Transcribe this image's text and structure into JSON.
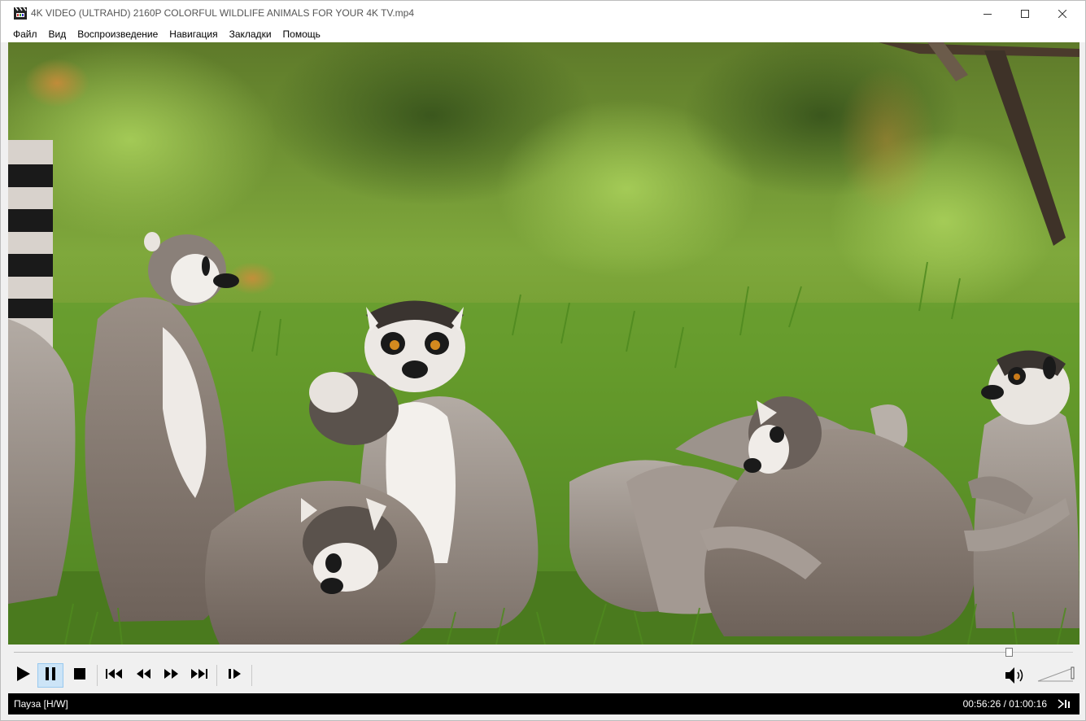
{
  "window": {
    "title": "4K VIDEO (ULTRAHD) 2160P COLORFUL WILDLIFE ANIMALS FOR YOUR 4K TV.mp4",
    "app_icon": "clapperboard-icon",
    "buttons": {
      "minimize": "minimize-icon",
      "maximize": "maximize-icon",
      "close": "close-icon"
    }
  },
  "menu": {
    "items": [
      "Файл",
      "Вид",
      "Воспроизведение",
      "Навигация",
      "Закладки",
      "Помощь"
    ]
  },
  "video": {
    "content": "video-frame"
  },
  "seekbar": {
    "progress": 0.9397
  },
  "controls": {
    "play": "play-icon",
    "pause": "pause-icon",
    "stop": "stop-icon",
    "prev": "skip-previous-icon",
    "rewind": "rewind-icon",
    "forward": "fast-forward-icon",
    "next": "skip-next-icon",
    "frame_step": "frame-step-icon",
    "volume": "speaker-icon",
    "active_button": "pause"
  },
  "status": {
    "state": "Пауза [H/W]",
    "time": "00:56:26 / 01:00:16",
    "icon": "stats-icon"
  },
  "colors": {
    "active_button_bg": "#cce4f7",
    "status_bg": "#000000",
    "chrome_bg": "#f0f0f0"
  }
}
